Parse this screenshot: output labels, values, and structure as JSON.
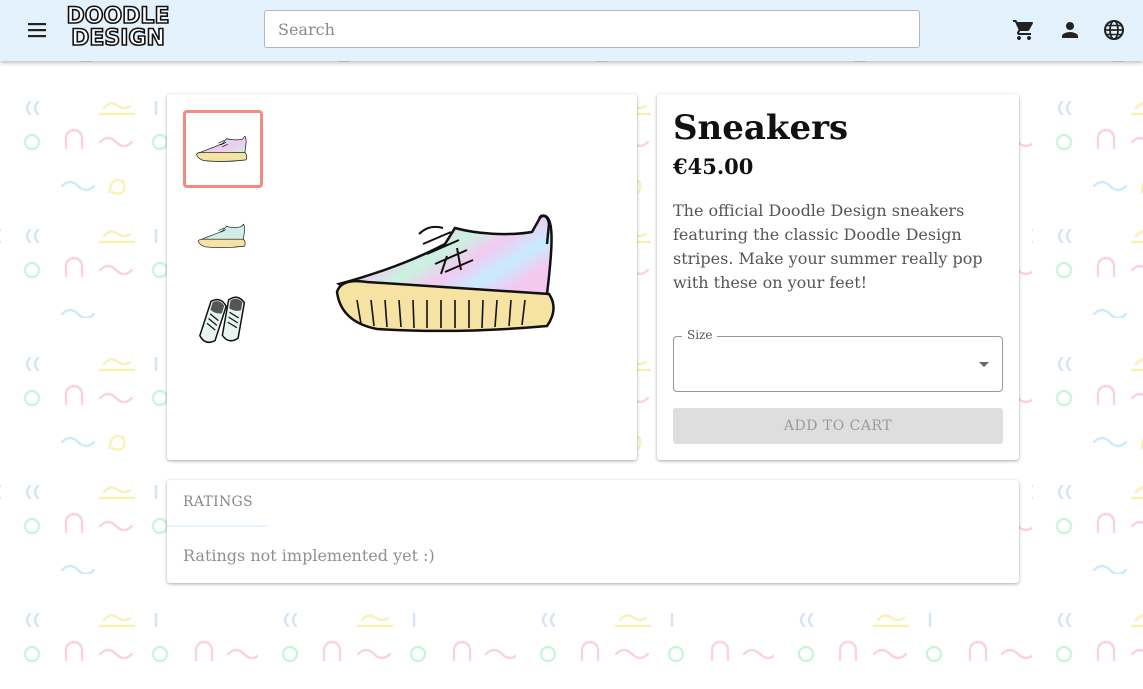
{
  "header": {
    "logo_line1": "DOODLE",
    "logo_line2": "DESIGN",
    "search_placeholder": "Search",
    "icons": [
      "menu-icon",
      "cart-icon",
      "account-icon",
      "globe-icon"
    ]
  },
  "gallery": {
    "thumbnails": [
      "sneaker-side-view",
      "sneaker-side-view-small",
      "sneakers-pair-top-view"
    ],
    "selected_index": 0
  },
  "product": {
    "title": "Sneakers",
    "price": "€45.00",
    "description": "The official Doodle Design sneakers featuring the classic Doodle Design stripes. Make your summer really pop with these on your feet!",
    "size_label": "Size",
    "size_value": "",
    "add_to_cart_label": "ADD TO CART"
  },
  "ratings": {
    "tab_label": "RATINGS",
    "message": "Ratings not implemented yet :)"
  },
  "colors": {
    "appbar": "#e3f2fd",
    "selected_thumb_border": "#f28b82",
    "disabled_button": "#dedede"
  }
}
